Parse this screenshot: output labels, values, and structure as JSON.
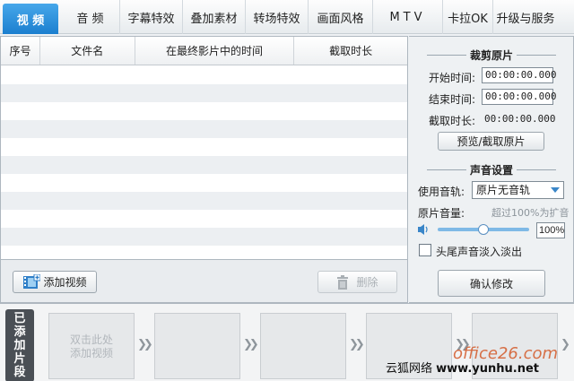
{
  "tabs": [
    {
      "label": "视 频",
      "active": true
    },
    {
      "label": "音 频"
    },
    {
      "label": "字幕特效"
    },
    {
      "label": "叠加素材"
    },
    {
      "label": "转场特效"
    },
    {
      "label": "画面风格"
    },
    {
      "label": "MTV"
    },
    {
      "label": "卡拉OK"
    },
    {
      "label": "升级与服务"
    }
  ],
  "list": {
    "columns": [
      "序号",
      "文件名",
      "在最终影片中的时间",
      "截取时长"
    ]
  },
  "buttons": {
    "add_video": "添加视频",
    "delete": "删除"
  },
  "crop": {
    "title": "裁剪原片",
    "start_label": "开始时间:",
    "start_value": "00:00:00.000",
    "end_label": "结束时间:",
    "end_value": "00:00:00.000",
    "duration_label": "截取时长:",
    "duration_value": "00:00:00.000",
    "preview_button": "预览/截取原片"
  },
  "audio": {
    "title": "声音设置",
    "track_label": "使用音轨:",
    "track_value": "原片无音轨",
    "volume_label": "原片音量:",
    "volume_hint": "超过100%为扩音",
    "volume_value": "100%",
    "volume_level": 0.5,
    "fade_label": "头尾声音淡入淡出",
    "fade_checked": false
  },
  "confirm_button": "确认修改",
  "strip": {
    "label": [
      "已",
      "添",
      "加",
      "片",
      "段"
    ],
    "first_slot_text": [
      "双击此处",
      "添加视频"
    ]
  },
  "watermark": {
    "text": "云狐网络",
    "url": "www.yunhu.net",
    "logo": "office26.com"
  },
  "colors": {
    "accent": "#1c7fcf"
  }
}
